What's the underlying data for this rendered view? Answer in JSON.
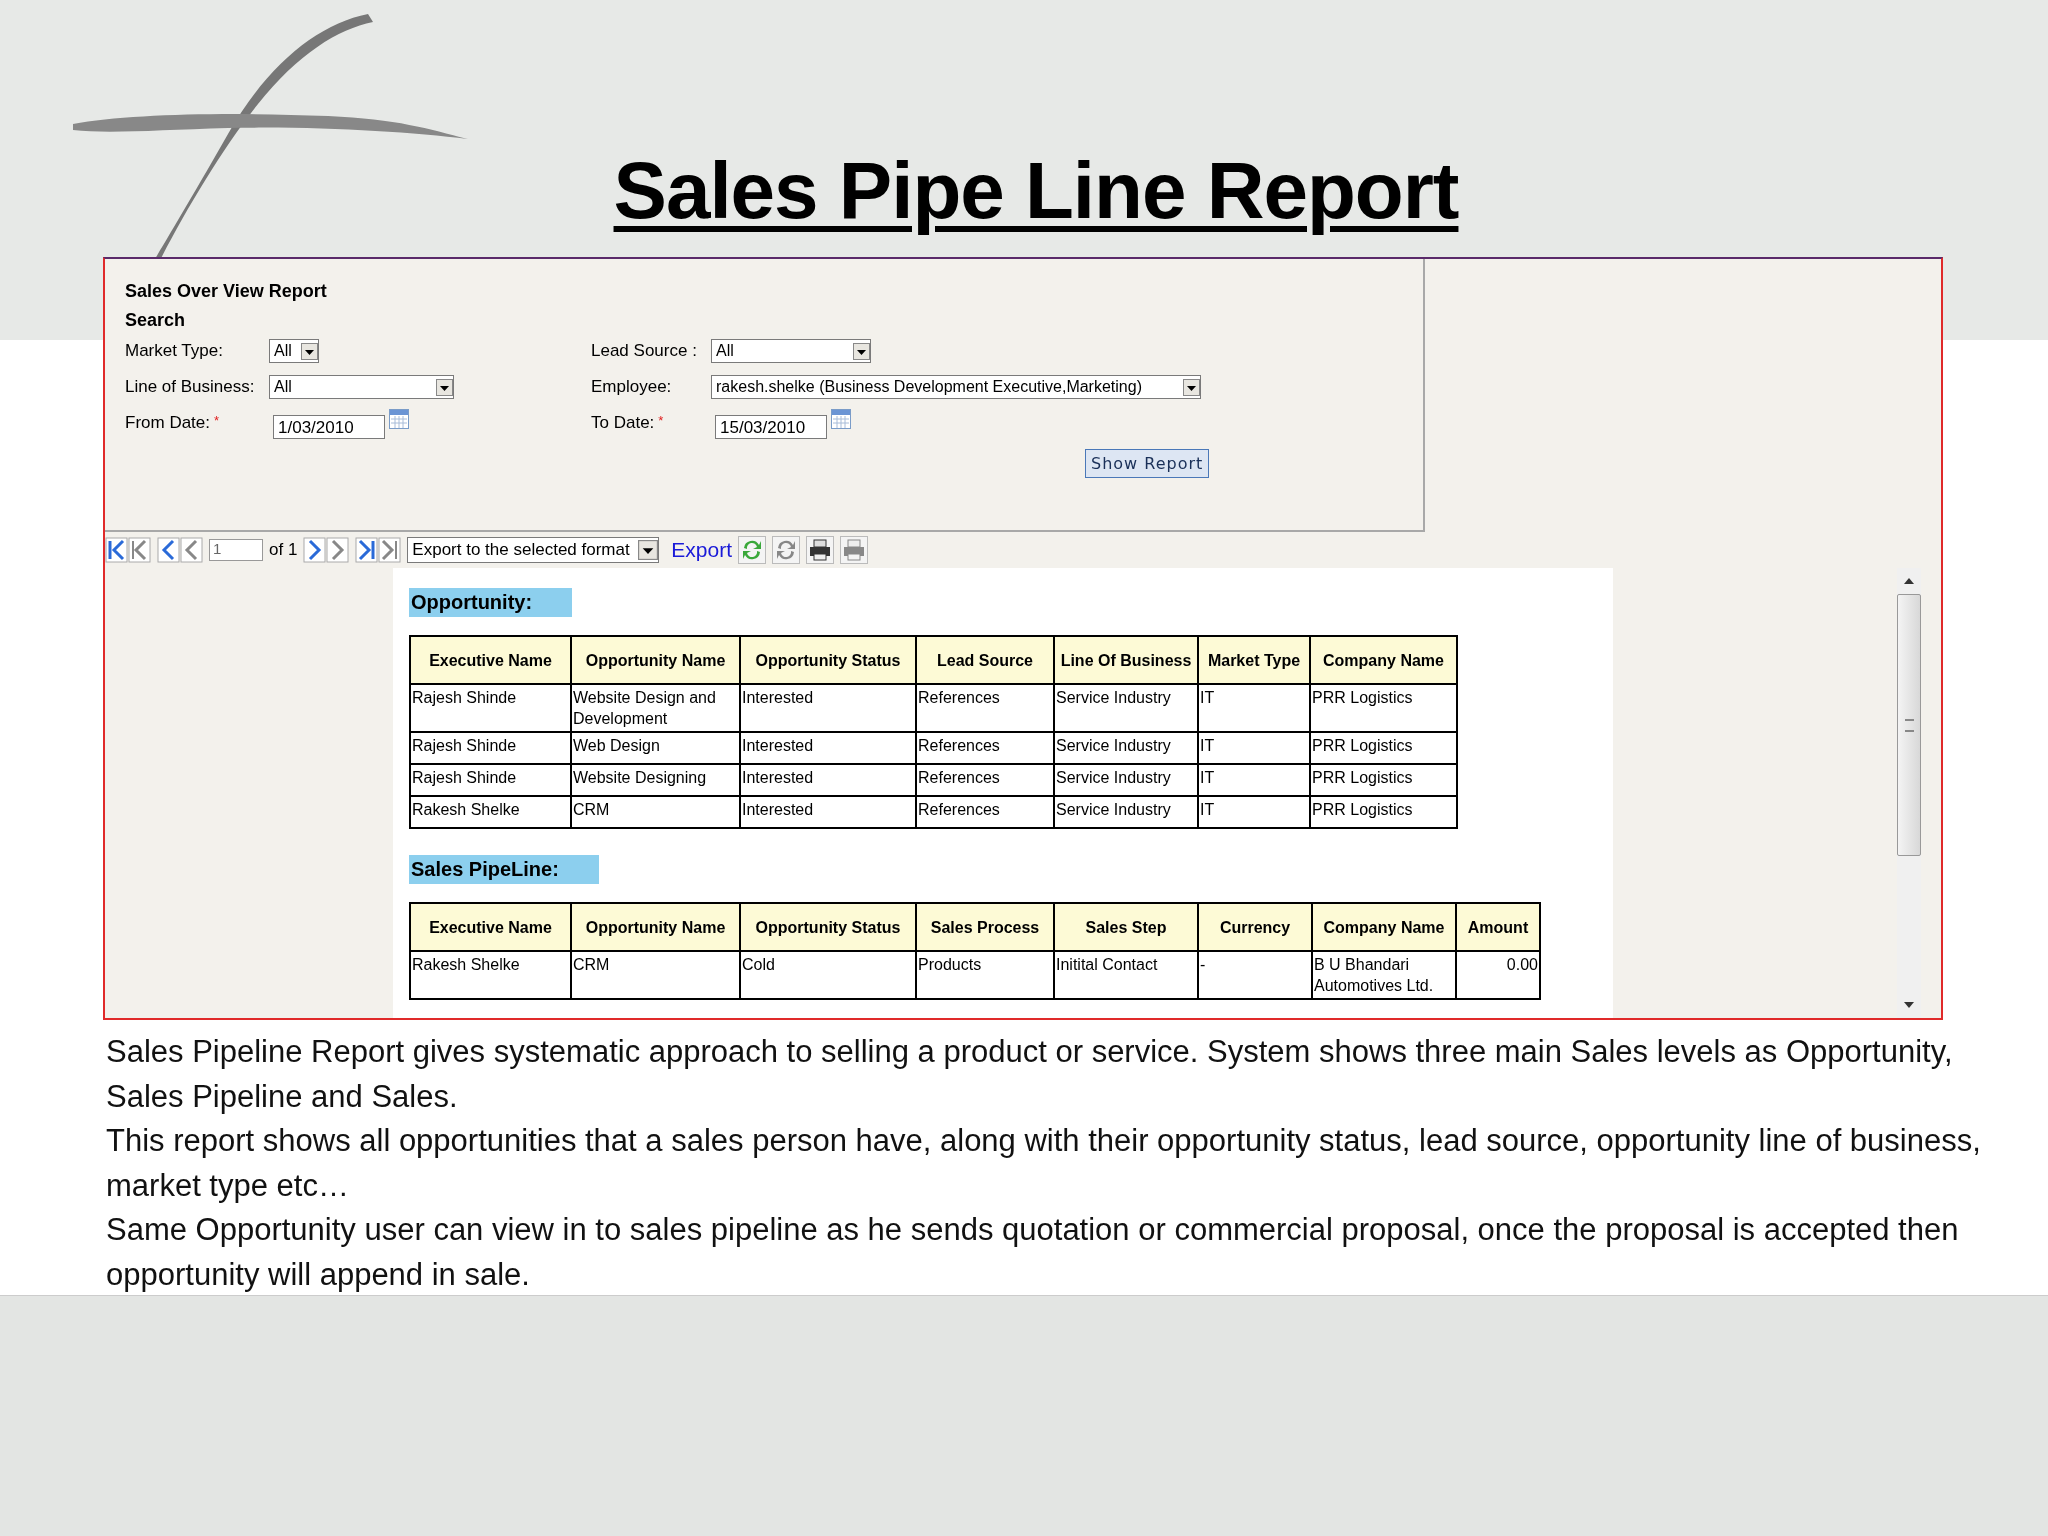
{
  "title": "Sales Pipe Line Report",
  "report_window": {
    "form": {
      "title": "Sales Over View Report",
      "section": "Search",
      "fields": [
        {
          "kind": "select",
          "label": "Market Type:",
          "value": "All"
        },
        {
          "kind": "select",
          "label": "Lead Source :",
          "value": "All"
        },
        {
          "kind": "select",
          "label": "Line of Business:",
          "value": "All"
        },
        {
          "kind": "select",
          "label": "Employee:",
          "value": "rakesh.shelke (Business Development Executive,Marketing)"
        },
        {
          "kind": "date",
          "label": "From Date:",
          "value": "1/03/2010",
          "required_mark": "*"
        },
        {
          "kind": "date",
          "label": "To Date:",
          "value": "15/03/2010",
          "required_mark": "*"
        }
      ],
      "button": "Show Report"
    },
    "toolbar": {
      "page": "1",
      "page_count": "of 1",
      "export_format": "Export to the selected format",
      "export_link": "Export"
    },
    "sections": [
      {
        "heading": "Opportunity:",
        "columns": [
          {
            "label": "Executive Name",
            "kind": "text"
          },
          {
            "label": "Opportunity Name",
            "kind": "text"
          },
          {
            "label": "Opportunity Status",
            "kind": "text"
          },
          {
            "label": "Lead Source",
            "kind": "text"
          },
          {
            "label": "Line Of Business",
            "kind": "text"
          },
          {
            "label": "Market Type",
            "kind": "text"
          },
          {
            "label": "Company Name",
            "kind": "text"
          }
        ],
        "rows": [
          [
            "Rajesh Shinde",
            "Website Design and Development",
            "Interested",
            "References",
            "Service Industry",
            "IT",
            "PRR Logistics"
          ],
          [
            "Rajesh Shinde",
            "Web Design",
            "Interested",
            "References",
            "Service Industry",
            "IT",
            "PRR Logistics"
          ],
          [
            "Rajesh Shinde",
            "Website Designing",
            "Interested",
            "References",
            "Service Industry",
            "IT",
            "PRR Logistics"
          ],
          [
            "Rakesh Shelke",
            "CRM",
            "Interested",
            "References",
            "Service Industry",
            "IT",
            "PRR Logistics"
          ]
        ]
      },
      {
        "heading": "Sales PipeLine:",
        "columns": [
          {
            "label": "Executive Name",
            "kind": "text"
          },
          {
            "label": "Opportunity Name",
            "kind": "text"
          },
          {
            "label": "Opportunity Status",
            "kind": "text"
          },
          {
            "label": "Sales Process",
            "kind": "text"
          },
          {
            "label": "Sales Step",
            "kind": "text"
          },
          {
            "label": "Currency",
            "kind": "text"
          },
          {
            "label": "Company Name",
            "kind": "text"
          },
          {
            "label": "Amount",
            "kind": "number"
          }
        ],
        "rows": [
          [
            "Rakesh Shelke",
            "CRM",
            "Cold",
            "Products",
            "Initital Contact",
            "-",
            "B U Bhandari Automotives Ltd.",
            "0.00"
          ]
        ]
      }
    ]
  },
  "description": [
    "Sales Pipeline Report gives systematic approach to selling a product or service. System shows three main Sales levels as Opportunity, Sales Pipeline and Sales.",
    "This report shows all opportunities that a sales person have, along with their opportunity status, lead source, opportunity line of business, market type etc…",
    "Same Opportunity user can view in to sales pipeline as he sends quotation or commercial proposal, once the proposal is accepted  then opportunity will append in sale."
  ]
}
